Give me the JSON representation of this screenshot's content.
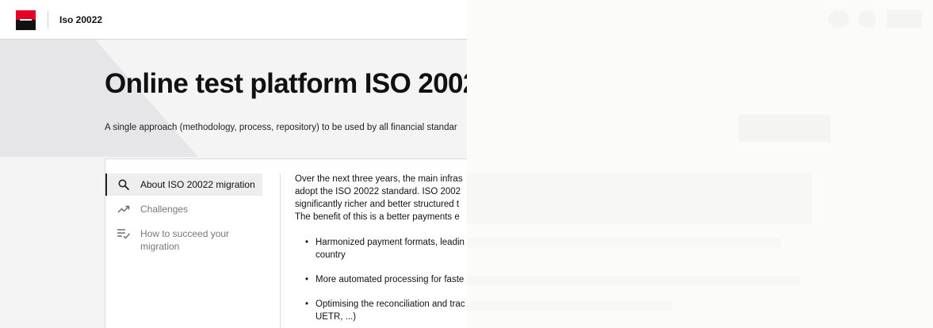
{
  "header": {
    "app_title": "Iso 20022"
  },
  "hero": {
    "title": "Online test platform ISO 2002",
    "subtitle": "A single approach (methodology, process, repository) to be used by all financial standar"
  },
  "sidenav": {
    "items": [
      {
        "label": "About ISO 20022 migration",
        "icon": "search-icon",
        "active": true
      },
      {
        "label": "Challenges",
        "icon": "trending-up-icon",
        "active": false
      },
      {
        "label": "How to succeed your\nmigration",
        "icon": "checklist-icon",
        "active": false
      }
    ]
  },
  "article": {
    "intro": "Over the next three years, the main infras\nadopt the ISO 20022 standard. ISO 2002\nsignificantly richer and better structured t\nThe benefit of this is a better payments e",
    "bullets": [
      "Harmonized payment formats, leadin\ncountry",
      "More automated processing for faste",
      "Optimising the reconciliation and trac\nUETR, ...)"
    ]
  },
  "colors": {
    "brand_red": "#e60028",
    "brand_black": "#111111",
    "hero_background": "#f4f4f5"
  }
}
